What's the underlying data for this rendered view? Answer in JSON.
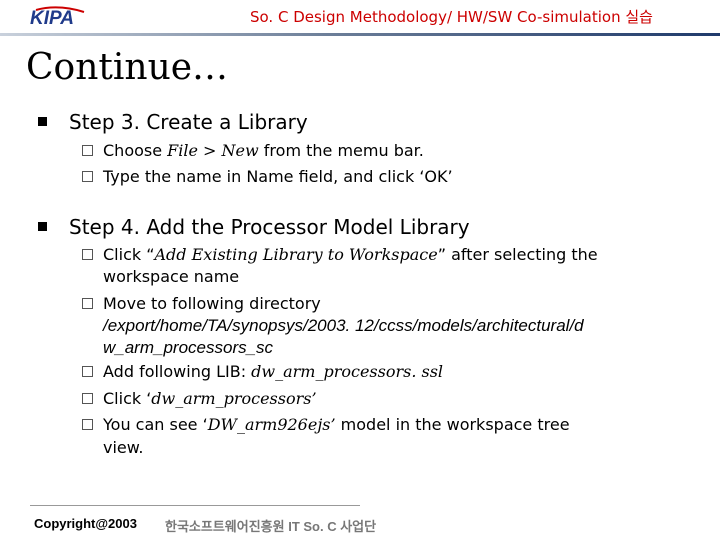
{
  "header": {
    "logo_text": "KIPA",
    "title": "So. C Design Methodology/ HW/SW Co-simulation 실습"
  },
  "slide": {
    "title": "Continue…",
    "step3": {
      "heading": "Step 3. Create a Library",
      "items": [
        [
          "Choose ",
          "File > New",
          " from the memu bar."
        ],
        [
          "Type the name in Name field, and click ‘OK’"
        ]
      ]
    },
    "step4": {
      "heading": "Step 4. Add the Processor Model Library",
      "items": [
        {
          "pre": "Click “",
          "em": "Add Existing Library to Workspace",
          "post": "” after selecting the"
        },
        {
          "cont": "workspace name"
        },
        {
          "text": "Move to following directory"
        },
        {
          "path1": "/export/home/TA/synopsys/2003. 12/ccss/models/architectural/d"
        },
        {
          "path2": "w_arm_processors_sc"
        },
        {
          "pre": "Add following LIB: ",
          "em": "dw_arm_processors. ssl"
        },
        {
          "pre": "Click ‘",
          "em": "dw_arm_processors’"
        },
        {
          "pre": "You can see ‘",
          "em": "DW_arm926ejs’",
          "post": " model in the workspace tree"
        },
        {
          "cont": "view."
        }
      ]
    }
  },
  "footer": {
    "copyright": "Copyright@2003",
    "org": "한국소프트웨어진흥원 IT So. C 사업단"
  }
}
